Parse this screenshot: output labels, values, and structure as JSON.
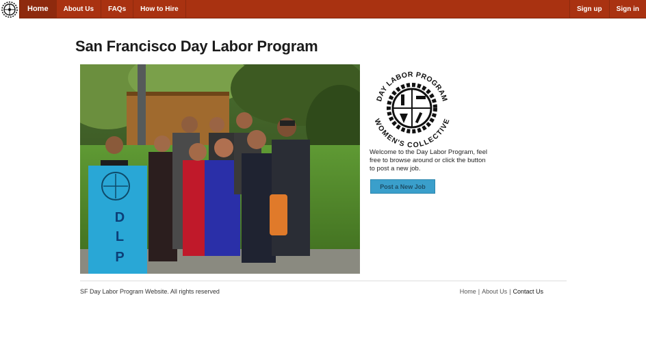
{
  "nav": {
    "logo_icon": "gear-badge-icon",
    "left_items": [
      {
        "label": "Home",
        "active": true
      },
      {
        "label": "About Us",
        "active": false
      },
      {
        "label": "FAQs",
        "active": false
      },
      {
        "label": "How to Hire",
        "active": false
      }
    ],
    "right_items": [
      {
        "label": "Sign up"
      },
      {
        "label": "Sign in"
      }
    ],
    "bar_color": "#a93211"
  },
  "page": {
    "title": "San Francisco Day Labor Program"
  },
  "hero": {
    "banner_text": "DLP",
    "image_icon": "group-photo-image"
  },
  "sidebar": {
    "logo_icon": "womens-collective-logo",
    "logo_text_top": "DAY LABOR PROGRAM",
    "logo_text_bottom": "WOMEN'S COLLECTIVE",
    "welcome_text": "Welcome to the Day Labor Program, feel free to browse around or click the button to post a new job.",
    "post_button_label": "Post a New Job",
    "button_color": "#3a9fcb"
  },
  "footer": {
    "copyright": "SF Day Labor Program Website. All rights reserved",
    "links": [
      "Home",
      "About Us",
      "Contact Us"
    ],
    "separator": "|"
  }
}
